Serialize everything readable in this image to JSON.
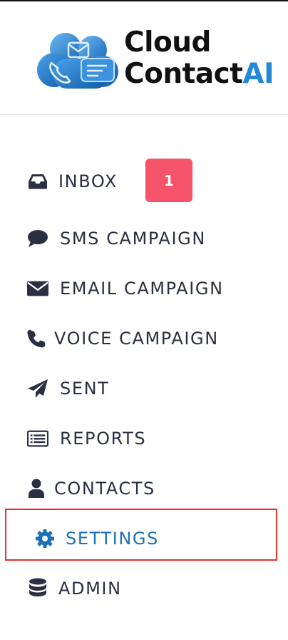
{
  "brand": {
    "line1": "Cloud",
    "line2_main": "Contact",
    "line2_accent": "AI",
    "accent_color": "#2488d8",
    "logo_icon": "cloud-chat-phone-logo"
  },
  "nav": {
    "items": [
      {
        "key": "inbox",
        "label": "INBOX",
        "icon": "inbox-icon",
        "badge": "1"
      },
      {
        "key": "sms",
        "label": "SMS CAMPAIGN",
        "icon": "chat-bubble-icon"
      },
      {
        "key": "email",
        "label": "EMAIL CAMPAIGN",
        "icon": "envelope-icon"
      },
      {
        "key": "voice",
        "label": "VOICE CAMPAIGN",
        "icon": "phone-icon"
      },
      {
        "key": "sent",
        "label": "SENT",
        "icon": "paper-plane-icon"
      },
      {
        "key": "reports",
        "label": "REPORTS",
        "icon": "list-alt-icon"
      },
      {
        "key": "contacts",
        "label": "CONTACTS",
        "icon": "user-icon"
      },
      {
        "key": "settings",
        "label": "SETTINGS",
        "icon": "gear-icon",
        "active": true
      },
      {
        "key": "admin",
        "label": "ADMIN",
        "icon": "database-icon"
      }
    ],
    "active_color": "#1d6fb8",
    "text_color": "#2a2f44",
    "badge_color": "#f5536a",
    "highlight_border_color": "#e0352b"
  }
}
